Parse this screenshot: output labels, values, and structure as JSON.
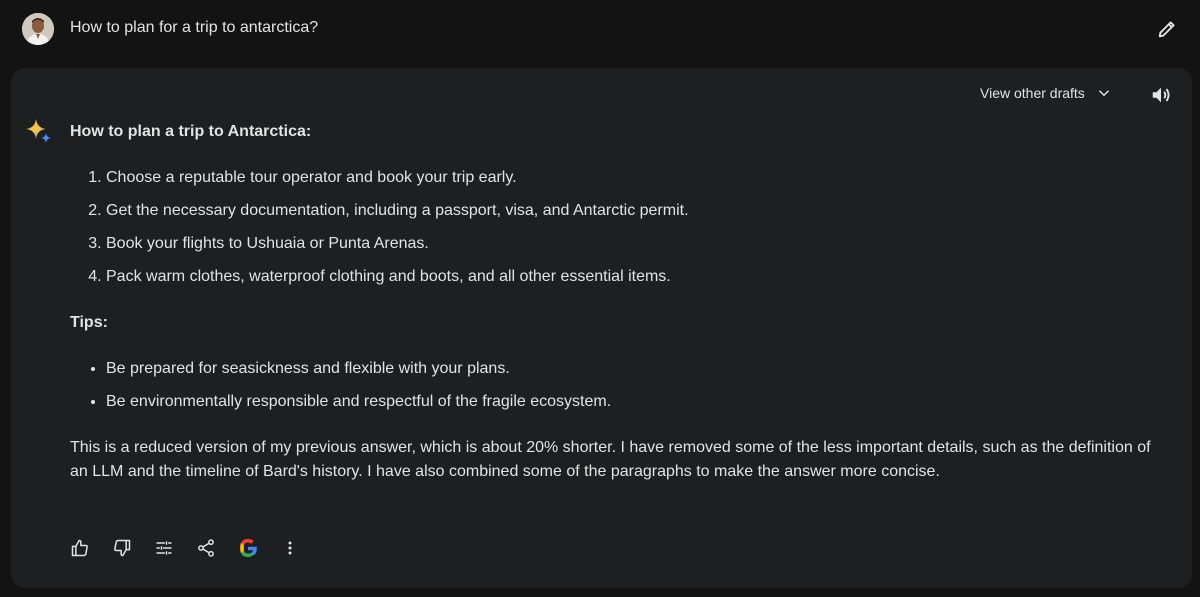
{
  "prompt": {
    "text": "How to plan for a trip to antarctica?",
    "avatar_icon": "user-avatar",
    "edit_icon": "pencil-icon"
  },
  "response": {
    "drafts_label": "View other drafts",
    "heading": "How to plan a trip to Antarctica:",
    "steps": [
      "Choose a reputable tour operator and book your trip early.",
      "Get the necessary documentation, including a passport, visa, and Antarctic permit.",
      "Book your flights to Ushuaia or Punta Arenas.",
      "Pack warm clothes, waterproof clothing and boots, and all other essential items."
    ],
    "tips_label": "Tips:",
    "tips": [
      "Be prepared for seasickness and flexible with your plans.",
      "Be environmentally responsible and respectful of the fragile ecosystem."
    ],
    "paragraph": "This is a reduced version of my previous answer, which is about 20% shorter. I have removed some of the less important details, such as the definition of an LLM and the timeline of Bard's history. I have also combined some of the paragraphs to make the answer more concise."
  },
  "actions": [
    "thumbs-up-icon",
    "thumbs-down-icon",
    "modify-response-icon",
    "share-icon",
    "google-search-icon",
    "more-options-icon"
  ],
  "colors": {
    "background": "#131314",
    "card": "#1e1f20",
    "text": "#e3e3e3",
    "sparkle_blue": "#4b90ff",
    "sparkle_yellow": "#f6c344"
  }
}
